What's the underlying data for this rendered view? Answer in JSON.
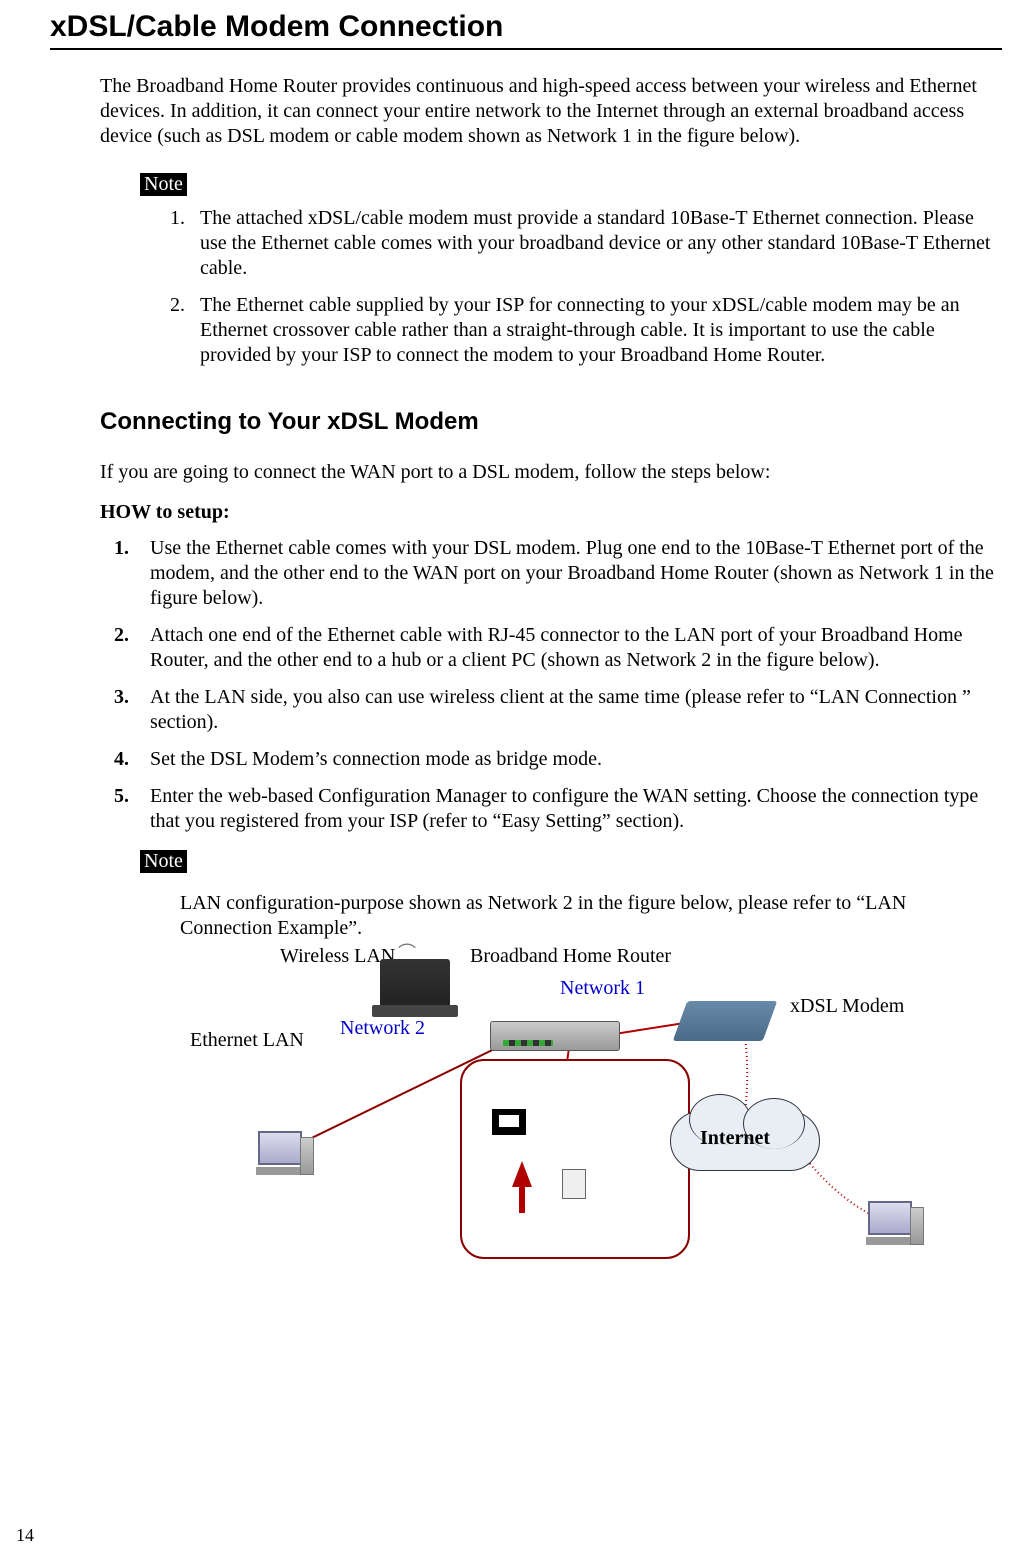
{
  "title": "xDSL/Cable Modem Connection",
  "intro": "The Broadband Home Router provides continuous and high-speed access between your wireless and Ethernet devices. In addition, it can connect your entire network to the Internet through an external broadband access device (such as DSL modem or cable modem shown as Network 1 in the figure below).",
  "note_label": "Note",
  "notes": [
    "The attached xDSL/cable modem must provide a standard 10Base-T Ethernet connection. Please use the Ethernet cable comes with your broadband device or any other standard 10Base-T Ethernet cable.",
    "The Ethernet cable supplied by your ISP for connecting to your xDSL/cable modem may be an Ethernet crossover cable rather than a straight-through cable. It is important to use the cable provided by your ISP to connect the modem to your Broadband Home Router."
  ],
  "subheading": "Connecting to Your xDSL Modem",
  "sub_intro": "If you are going to connect the WAN port to a DSL modem, follow the steps below:",
  "how_label": "HOW to setup:",
  "steps": [
    "Use the Ethernet cable comes with your DSL modem. Plug one end to the 10Base-T Ethernet port of the modem, and the other end to the WAN port on your Broadband Home Router (shown as Network 1 in the figure below).",
    "Attach one end of the Ethernet cable with RJ-45 connector to the LAN port of your Broadband Home Router, and the other end to a hub or a client PC (shown as Network 2 in the figure below).",
    "At the LAN side, you also can use wireless client at the same time (please refer to “LAN Connection ” section).",
    "Set the DSL Modem’s connection mode as bridge mode.",
    "Enter the web-based Configuration Manager to configure the WAN setting. Choose the connection type that you registered from your ISP (refer to “Easy Setting” section)."
  ],
  "note2_label": "Note",
  "note2_body": "LAN configuration-purpose shown as Network 2 in the figure below, please refer to “LAN Connection Example”.",
  "diagram": {
    "wireless_lan": "Wireless LAN",
    "router": "Broadband Home Router",
    "network1": "Network 1",
    "network2": "Network 2",
    "ethernet_lan": "Ethernet LAN",
    "modem": "xDSL Modem",
    "internet": "Internet"
  },
  "page_number": "14"
}
